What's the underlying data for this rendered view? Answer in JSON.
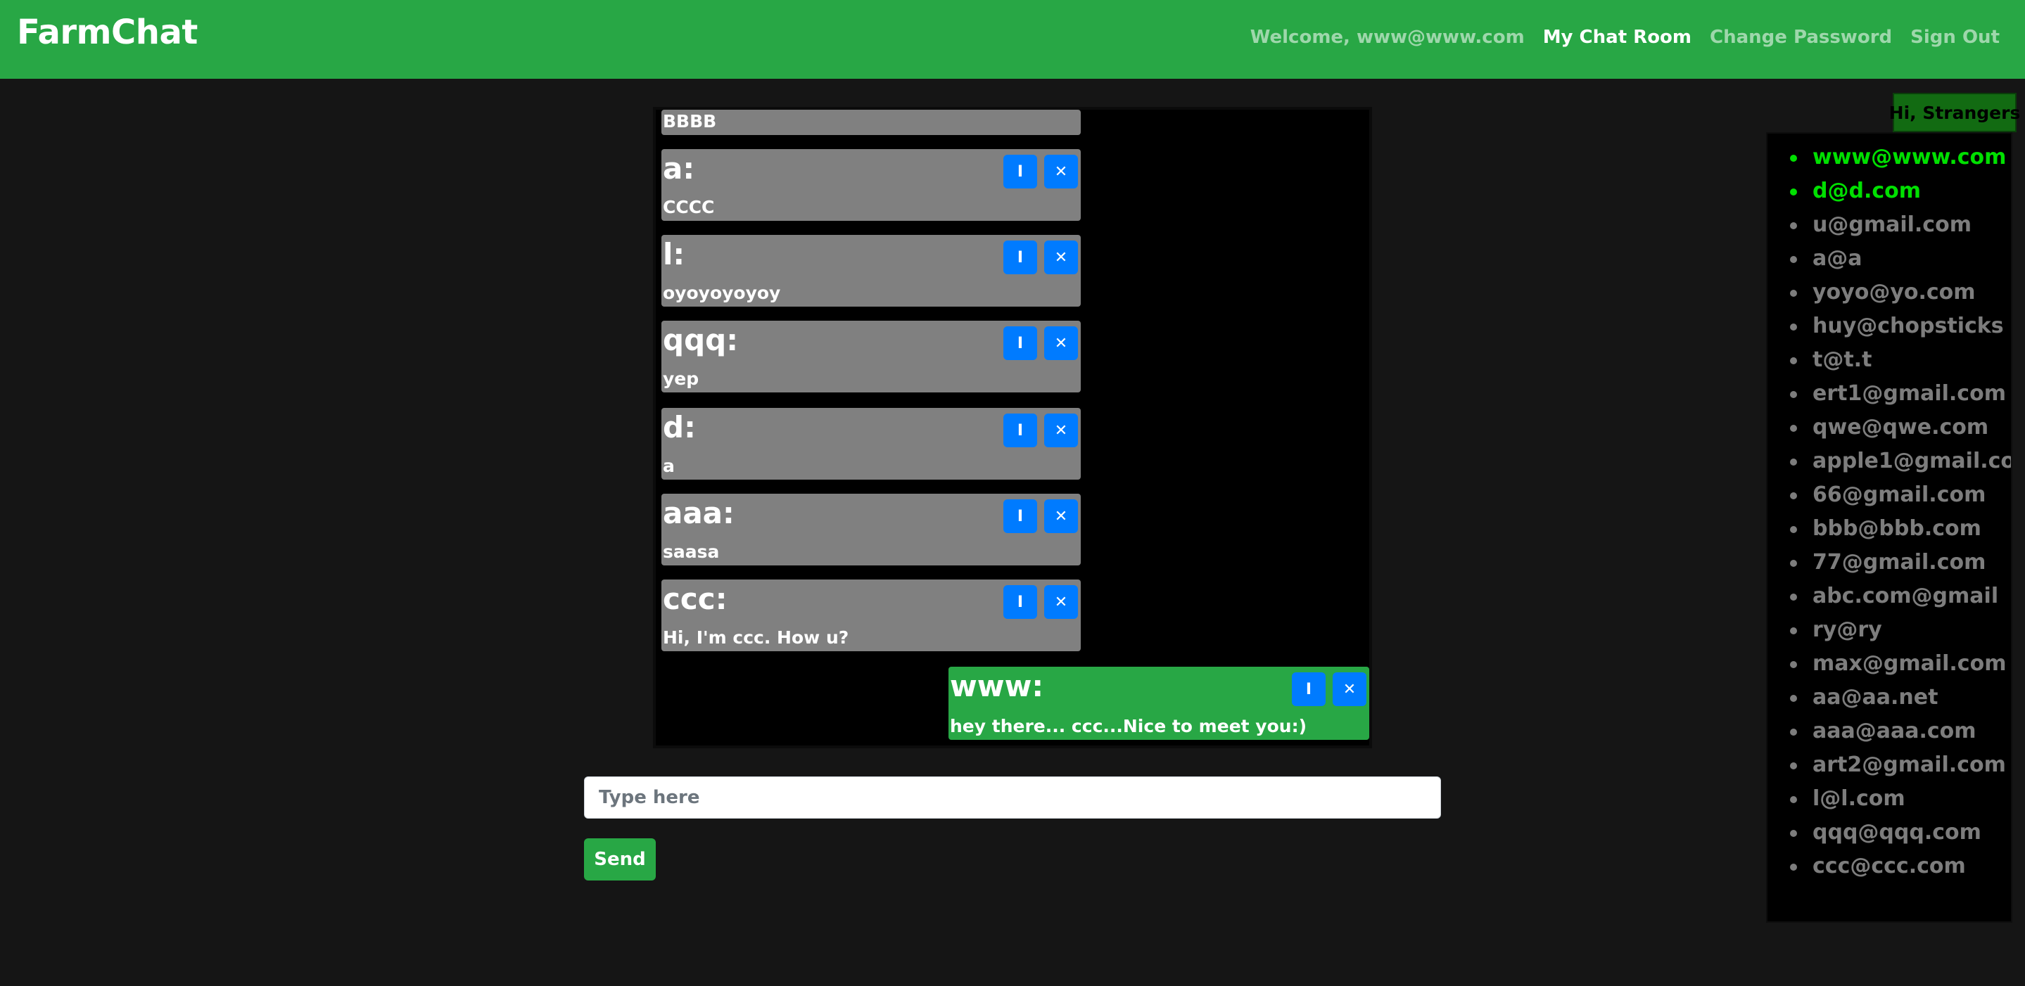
{
  "navbar": {
    "brand": "FarmChat",
    "welcome": "Welcome, www@www.com",
    "my_chat_room": "My Chat Room",
    "change_password": "Change Password",
    "sign_out": "Sign Out"
  },
  "chat": {
    "messages": [
      {
        "user": "",
        "text": "BBBB",
        "own": false
      },
      {
        "user": "a:",
        "text": "CCCC",
        "own": false
      },
      {
        "user": "l:",
        "text": "oyoyoyoyoy",
        "own": false
      },
      {
        "user": "qqq:",
        "text": "yep",
        "own": false
      },
      {
        "user": "d:",
        "text": "a",
        "own": false
      },
      {
        "user": "aaa:",
        "text": "saasa",
        "own": false
      },
      {
        "user": "ccc:",
        "text": "Hi, I'm ccc. How u?",
        "own": false
      },
      {
        "user": "www:",
        "text": "hey there... ccc...Nice to meet you:)",
        "own": true
      }
    ],
    "edit_label": "I",
    "delete_label": "✕"
  },
  "composer": {
    "placeholder": "Type here",
    "value": "",
    "send_label": "Send"
  },
  "strangers": {
    "title": "Hi, Strangers",
    "users": [
      {
        "email": "www@www.com",
        "online": true
      },
      {
        "email": "d@d.com",
        "online": true
      },
      {
        "email": "u@gmail.com",
        "online": false
      },
      {
        "email": "a@a",
        "online": false
      },
      {
        "email": "yoyo@yo.com",
        "online": false
      },
      {
        "email": "huy@chopsticks",
        "online": false
      },
      {
        "email": "t@t.t",
        "online": false
      },
      {
        "email": "ert1@gmail.com",
        "online": false
      },
      {
        "email": "qwe@qwe.com",
        "online": false
      },
      {
        "email": "apple1@gmail.co",
        "online": false
      },
      {
        "email": "66@gmail.com",
        "online": false
      },
      {
        "email": "bbb@bbb.com",
        "online": false
      },
      {
        "email": "77@gmail.com",
        "online": false
      },
      {
        "email": "abc.com@gmail",
        "online": false
      },
      {
        "email": "ry@ry",
        "online": false
      },
      {
        "email": "max@gmail.com",
        "online": false
      },
      {
        "email": "aa@aa.net",
        "online": false
      },
      {
        "email": "aaa@aaa.com",
        "online": false
      },
      {
        "email": "art2@gmail.com",
        "online": false
      },
      {
        "email": "l@l.com",
        "online": false
      },
      {
        "email": "qqq@qqq.com",
        "online": false
      },
      {
        "email": "ccc@ccc.com",
        "online": false
      }
    ]
  },
  "colors": {
    "brand_green": "#28a745",
    "button_blue": "#007bff",
    "message_gray": "#808080",
    "online_green": "#00e000",
    "offline_gray": "#7d7d7d"
  }
}
